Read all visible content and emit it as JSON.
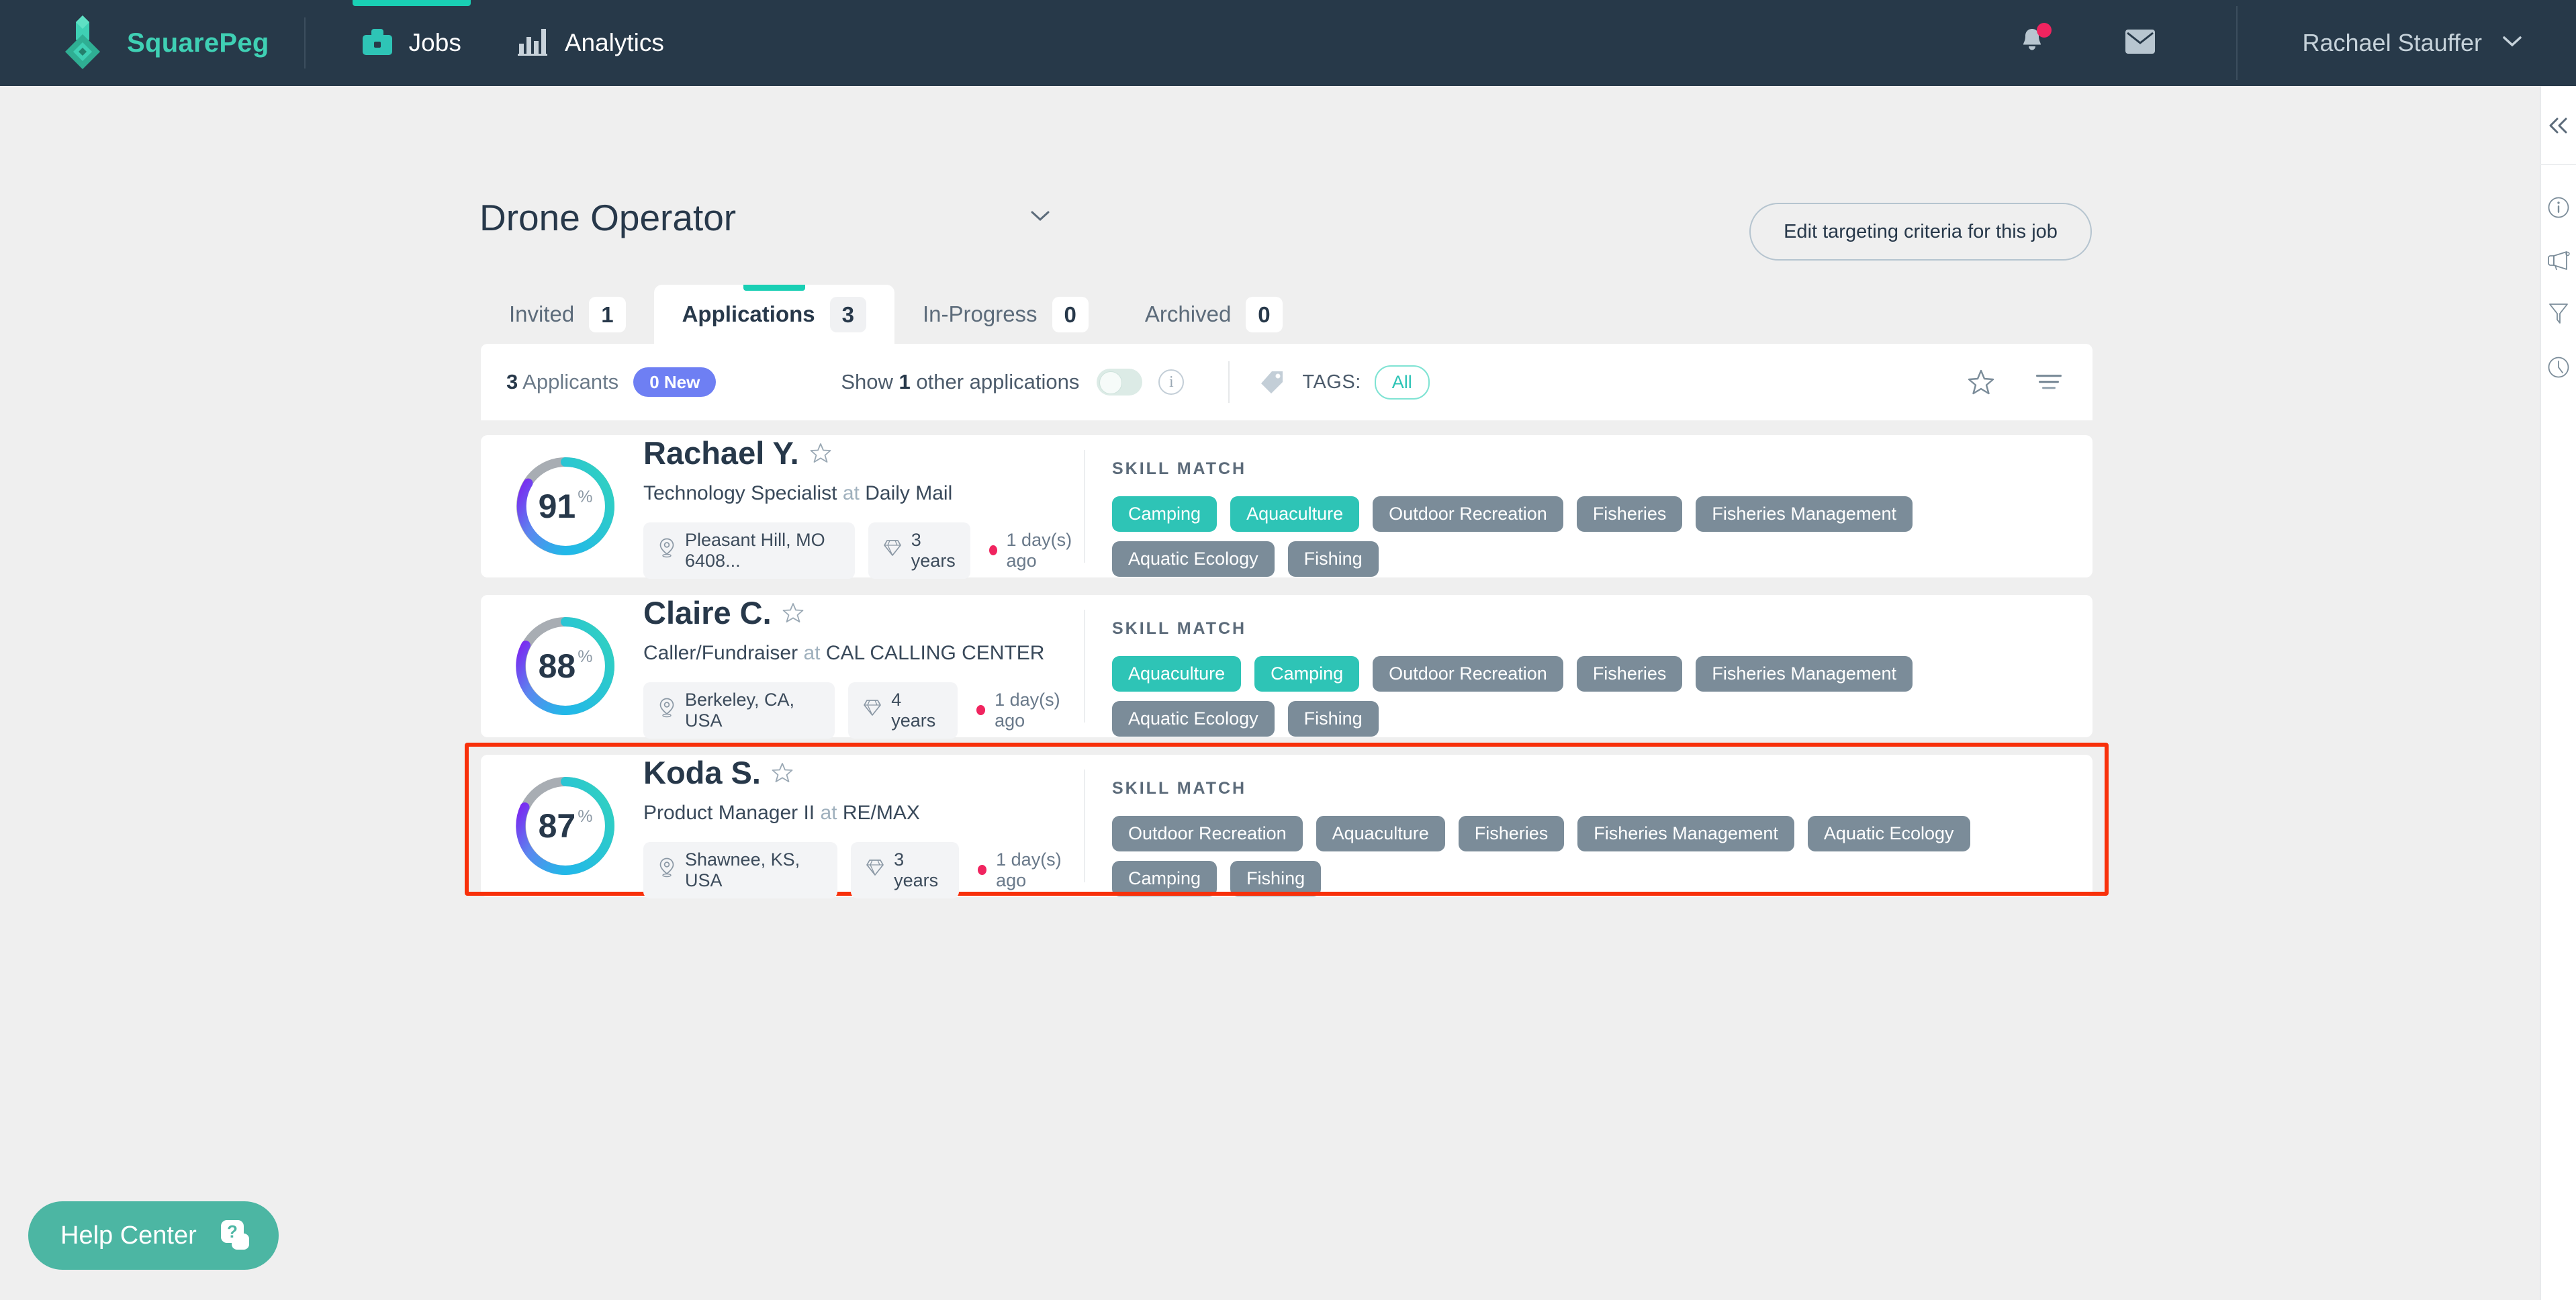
{
  "topbar": {
    "brand": "SquarePeg",
    "nav": [
      {
        "label": "Jobs",
        "icon": "briefcase-icon",
        "active": true
      },
      {
        "label": "Analytics",
        "icon": "bar-chart-icon",
        "active": false
      }
    ],
    "notifications_icon": "bell-icon",
    "messages_icon": "envelope-icon",
    "user_name": "Rachael Stauffer",
    "user_caret_icon": "chevron-down-icon",
    "bg_color": "#273949",
    "accent_color": "#19cfb4"
  },
  "header": {
    "job_title": "Drone Operator",
    "job_caret_icon": "chevron-down-icon",
    "edit_button": "Edit targeting criteria for this job"
  },
  "tabs": [
    {
      "label": "Invited",
      "count": "1",
      "active": false
    },
    {
      "label": "Applications",
      "count": "3",
      "active": true
    },
    {
      "label": "In-Progress",
      "count": "0",
      "active": false
    },
    {
      "label": "Archived",
      "count": "0",
      "active": false
    }
  ],
  "toolbar": {
    "applicants_count": "3",
    "applicants_word": "Applicants",
    "new_badge": "0 New",
    "new_badge_color": "#6e7ff3",
    "show_other_prefix": "Show",
    "show_other_count": "1",
    "show_other_suffix": "other applications",
    "toggle_state": "off",
    "info_icon": "info-icon",
    "tag_icon": "tag-icon",
    "tags_label": "TAGS:",
    "tags_value": "All",
    "star_icon": "star-icon",
    "sort_icon": "sort-lines-icon"
  },
  "skill_match_heading": "SKILL MATCH",
  "colors": {
    "match_tag": "#2ec4b6",
    "nomatch_tag": "#7b8c99",
    "highlight_border": "#f8300a",
    "page_bg": "#efefef"
  },
  "candidates": [
    {
      "score": "91",
      "score_unit": "%",
      "name": "Rachael Y.",
      "star_icon": "star-outline-icon",
      "role": "Technology Specialist",
      "at": "at",
      "company": "Daily Mail",
      "location_icon": "location-pin-icon",
      "location": "Pleasant Hill, MO 6408...",
      "experience_icon": "diamond-icon",
      "experience": "3 years",
      "applied_ago": "1 day(s) ago",
      "highlighted": false,
      "skills": [
        {
          "label": "Camping",
          "matched": true
        },
        {
          "label": "Aquaculture",
          "matched": true
        },
        {
          "label": "Outdoor Recreation",
          "matched": false
        },
        {
          "label": "Fisheries",
          "matched": false
        },
        {
          "label": "Fisheries Management",
          "matched": false
        },
        {
          "label": "Aquatic Ecology",
          "matched": false
        },
        {
          "label": "Fishing",
          "matched": false
        }
      ]
    },
    {
      "score": "88",
      "score_unit": "%",
      "name": "Claire C.",
      "star_icon": "star-outline-icon",
      "role": "Caller/Fundraiser",
      "at": "at",
      "company": "CAL CALLING CENTER",
      "location_icon": "location-pin-icon",
      "location": "Berkeley, CA, USA",
      "experience_icon": "diamond-icon",
      "experience": "4 years",
      "applied_ago": "1 day(s) ago",
      "highlighted": false,
      "skills": [
        {
          "label": "Aquaculture",
          "matched": true
        },
        {
          "label": "Camping",
          "matched": true
        },
        {
          "label": "Outdoor Recreation",
          "matched": false
        },
        {
          "label": "Fisheries",
          "matched": false
        },
        {
          "label": "Fisheries Management",
          "matched": false
        },
        {
          "label": "Aquatic Ecology",
          "matched": false
        },
        {
          "label": "Fishing",
          "matched": false
        }
      ]
    },
    {
      "score": "87",
      "score_unit": "%",
      "name": "Koda S.",
      "star_icon": "star-outline-icon",
      "role": "Product Manager II",
      "at": "at",
      "company": "RE/MAX",
      "location_icon": "location-pin-icon",
      "location": "Shawnee, KS, USA",
      "experience_icon": "diamond-icon",
      "experience": "3 years",
      "applied_ago": "1 day(s) ago",
      "highlighted": true,
      "skills": [
        {
          "label": "Outdoor Recreation",
          "matched": false
        },
        {
          "label": "Aquaculture",
          "matched": false
        },
        {
          "label": "Fisheries",
          "matched": false
        },
        {
          "label": "Fisheries Management",
          "matched": false
        },
        {
          "label": "Aquatic Ecology",
          "matched": false
        },
        {
          "label": "Camping",
          "matched": false
        },
        {
          "label": "Fishing",
          "matched": false
        }
      ]
    }
  ],
  "rail": [
    {
      "icon": "collapse-double-chevron-left-icon"
    },
    {
      "icon": "info-circle-icon"
    },
    {
      "icon": "megaphone-icon"
    },
    {
      "icon": "funnel-filter-icon"
    },
    {
      "icon": "clock-icon"
    }
  ],
  "help": {
    "label": "Help Center",
    "icon": "question-card-icon",
    "color": "#4cb6a3"
  }
}
